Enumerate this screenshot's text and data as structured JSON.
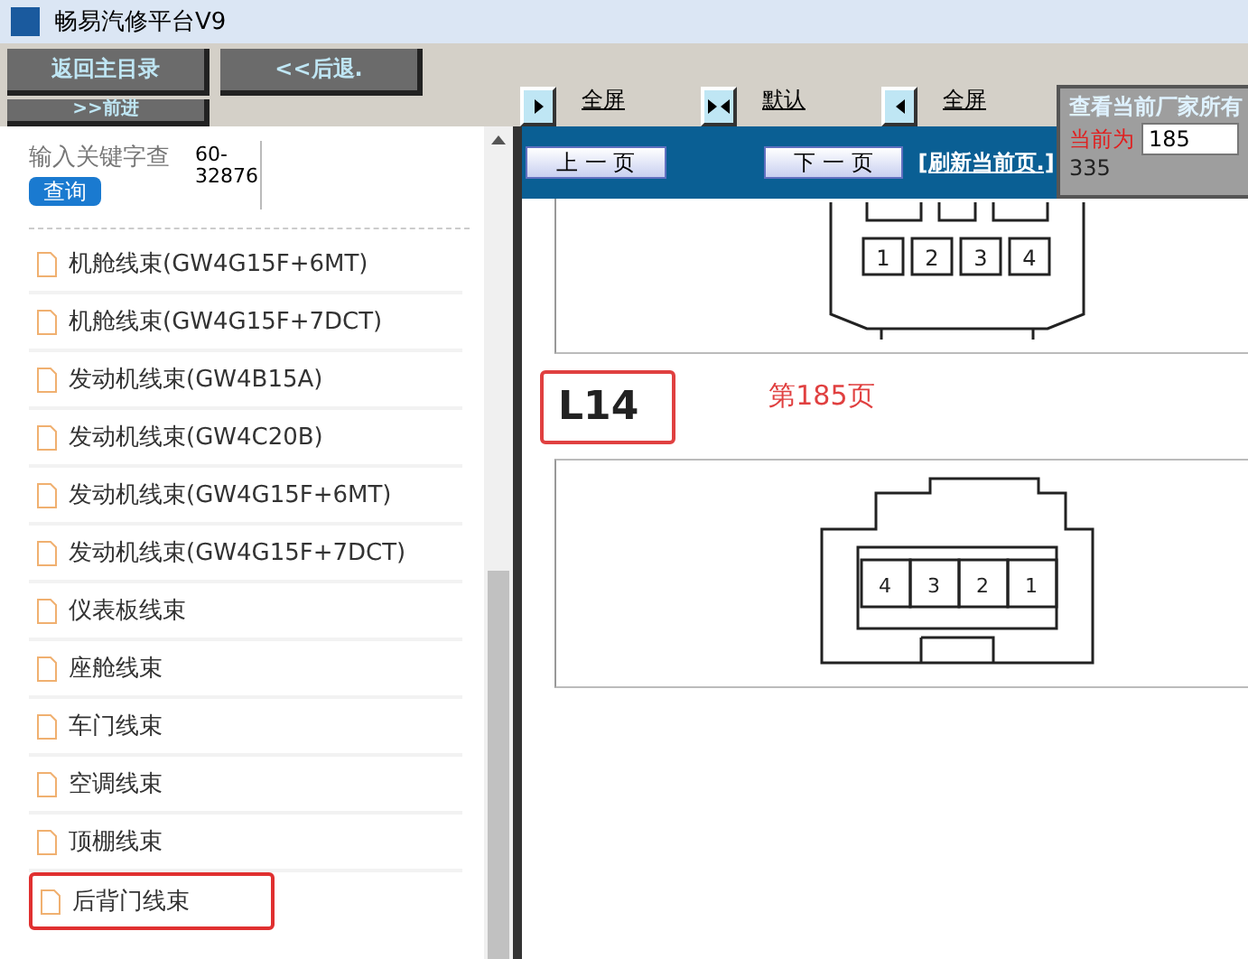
{
  "window": {
    "title": "畅易汽修平台V9"
  },
  "toolbar": {
    "buttons": [
      {
        "label": "返回主目录"
      },
      {
        "label": "<<后退."
      },
      {
        "label": ">>前进"
      }
    ],
    "view_tools": [
      {
        "kind": "right",
        "label": "全屏"
      },
      {
        "kind": "both",
        "label": "默认"
      },
      {
        "kind": "left",
        "label": "全屏"
      }
    ]
  },
  "sidebar": {
    "search": {
      "label": "输入关键字查",
      "button": "查询",
      "value": "60-\n32876"
    },
    "items": [
      {
        "label": "机舱线束(GW4G15F+6MT)",
        "highlighted": false
      },
      {
        "label": "机舱线束(GW4G15F+7DCT)",
        "highlighted": false
      },
      {
        "label": "发动机线束(GW4B15A)",
        "highlighted": false
      },
      {
        "label": "发动机线束(GW4C20B)",
        "highlighted": false
      },
      {
        "label": "发动机线束(GW4G15F+6MT)",
        "highlighted": false
      },
      {
        "label": "发动机线束(GW4G15F+7DCT)",
        "highlighted": false
      },
      {
        "label": "仪表板线束",
        "highlighted": false
      },
      {
        "label": "座舱线束",
        "highlighted": false
      },
      {
        "label": "车门线束",
        "highlighted": false
      },
      {
        "label": "空调线束",
        "highlighted": false
      },
      {
        "label": "顶棚线束",
        "highlighted": false
      },
      {
        "label": "后背门线束",
        "highlighted": true
      }
    ]
  },
  "nav": {
    "prev": "上 一 页",
    "next": "下 一 页",
    "refresh": "[刷新当前页.]"
  },
  "page_box": {
    "title": "查看当前厂家所有",
    "current_label": "当前为",
    "current_value": "185",
    "total": "335"
  },
  "document": {
    "connectors": [
      {
        "code": "L14",
        "page": "第185页",
        "pins": [
          "4",
          "3",
          "2",
          "1"
        ]
      }
    ],
    "previous_pins": [
      "1",
      "2",
      "3",
      "4"
    ]
  }
}
